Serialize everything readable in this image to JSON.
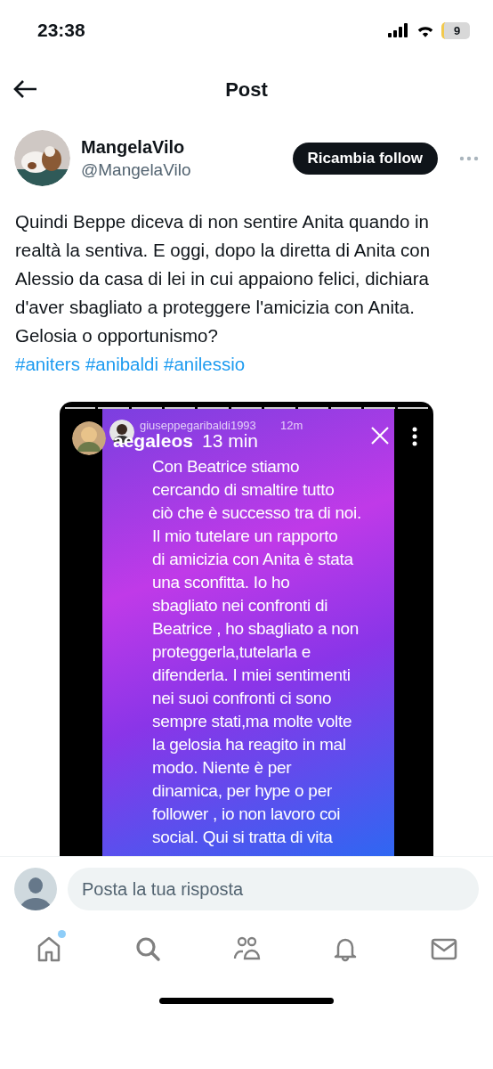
{
  "status_bar": {
    "time": "23:38",
    "battery": "9"
  },
  "header": {
    "title": "Post"
  },
  "post": {
    "author": {
      "name": "MangelaVilo",
      "handle": "@MangelaVilo"
    },
    "follow_button": "Ricambia follow",
    "text": "Quindi Beppe diceva di non sentire Anita quando in realtà la sentiva. E oggi, dopo la diretta di Anita con Alessio da casa di lei in cui appaiono felici, dichiara d'aver sbagliato a proteggere l'amicizia con Anita. Gelosia o opportunismo?",
    "hashtags": [
      "#aniters",
      "#anibaldi",
      "#anilessio"
    ],
    "media": {
      "kind": "story_screenshot",
      "outer_user": "aegaleos",
      "outer_time": "13 min",
      "inner_user": "giuseppegaribaldi1993",
      "inner_time": "12m",
      "story_text": "Con Beatrice stiamo\ncercando di smaltire tutto\nciò che è successo tra di noi.\nIl mio tutelare un rapporto\ndi amicizia con Anita è stata\nuna sconfitta. Io ho\nsbagliato nei confronti di\nBeatrice , ho sbagliato a non\nproteggerla,tutelarla e\ndifenderla. I miei sentimenti\nnei suoi confronti ci sono\nsempre stati,ma molte volte\nla gelosia ha reagito in mal\nmodo. Niente è per\ndinamica, per hype o per\nfollower , io non lavoro coi\nsocial. Qui si tratta di vita"
    }
  },
  "reply": {
    "placeholder": "Posta la tua risposta"
  },
  "tab_bar": [
    {
      "kind": "home",
      "badge": true
    },
    {
      "kind": "search",
      "badge": false
    },
    {
      "kind": "communities",
      "badge": false
    },
    {
      "kind": "notifications",
      "badge": false
    },
    {
      "kind": "messages",
      "badge": false
    }
  ]
}
